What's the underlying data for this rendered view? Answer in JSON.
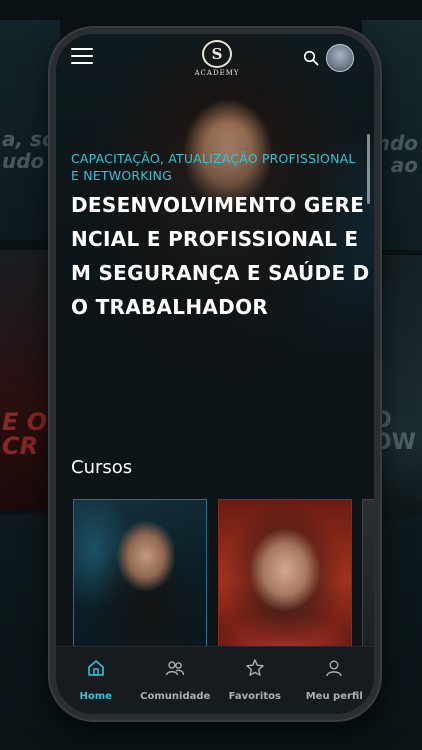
{
  "app": {
    "logo_mark": "S",
    "logo_text": "ACADEMY"
  },
  "background": {
    "left_text": "a, sou\nudo Co",
    "right_text": "ndo\nao",
    "left_text_2": "E OF\nCR",
    "right_text_2": "O\nOW"
  },
  "hero": {
    "subtitle": "CAPACITAÇÃO, ATUALIZAÇÃO PROFISSIONAL E NETWORKING",
    "title": "DESENVOLVIMENTO GERENCIAL E PROFISSIONAL EM SEGURANÇA E SAÚDE DO TRABALHADOR"
  },
  "courses": {
    "heading": "Cursos"
  },
  "bottom_nav": {
    "items": [
      {
        "label": "Home",
        "icon": "home-icon",
        "active": true
      },
      {
        "label": "Comunidade",
        "icon": "community-icon",
        "active": false
      },
      {
        "label": "Favoritos",
        "icon": "star-icon",
        "active": false
      },
      {
        "label": "Meu perfil",
        "icon": "profile-icon",
        "active": false
      }
    ]
  },
  "colors": {
    "accent": "#2fc6d6",
    "background": "#0d1417",
    "nav_background": "#151b1f",
    "text_primary": "#ffffff",
    "text_muted": "#a9b1b7"
  }
}
